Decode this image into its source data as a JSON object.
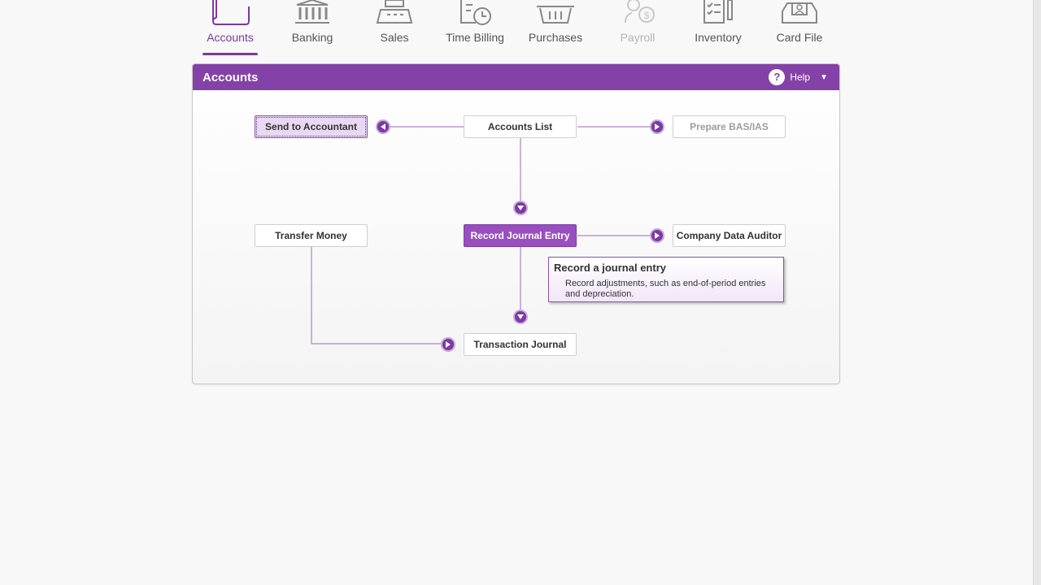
{
  "nav": {
    "items": [
      {
        "label": "Accounts",
        "icon": "folder-icon",
        "state": "active"
      },
      {
        "label": "Banking",
        "icon": "bank-icon",
        "state": "normal"
      },
      {
        "label": "Sales",
        "icon": "cash-register-icon",
        "state": "normal"
      },
      {
        "label": "Time Billing",
        "icon": "clock-document-icon",
        "state": "normal"
      },
      {
        "label": "Purchases",
        "icon": "basket-icon",
        "state": "normal"
      },
      {
        "label": "Payroll",
        "icon": "payroll-person-dollar-icon",
        "state": "disabled"
      },
      {
        "label": "Inventory",
        "icon": "checklist-icon",
        "state": "normal"
      },
      {
        "label": "Card File",
        "icon": "card-file-icon",
        "state": "normal"
      }
    ]
  },
  "panel": {
    "title": "Accounts",
    "help_label": "Help",
    "help_glyph": "?",
    "help_caret": "▼"
  },
  "flow": {
    "send_to_accountant": "Send to Accountant",
    "accounts_list": "Accounts List",
    "prepare_bas": "Prepare BAS/IAS",
    "transfer_money": "Transfer Money",
    "record_journal_entry": "Record Journal Entry",
    "company_data_auditor": "Company Data Auditor",
    "transaction_journal": "Transaction Journal"
  },
  "tooltip": {
    "title": "Record a journal entry",
    "body": "Record adjustments, such as end-of-period entries and depreciation."
  },
  "colors": {
    "brand_purple": "#8441a8",
    "accent_purple": "#7b3aa2",
    "connector": "#9b6bb6"
  }
}
